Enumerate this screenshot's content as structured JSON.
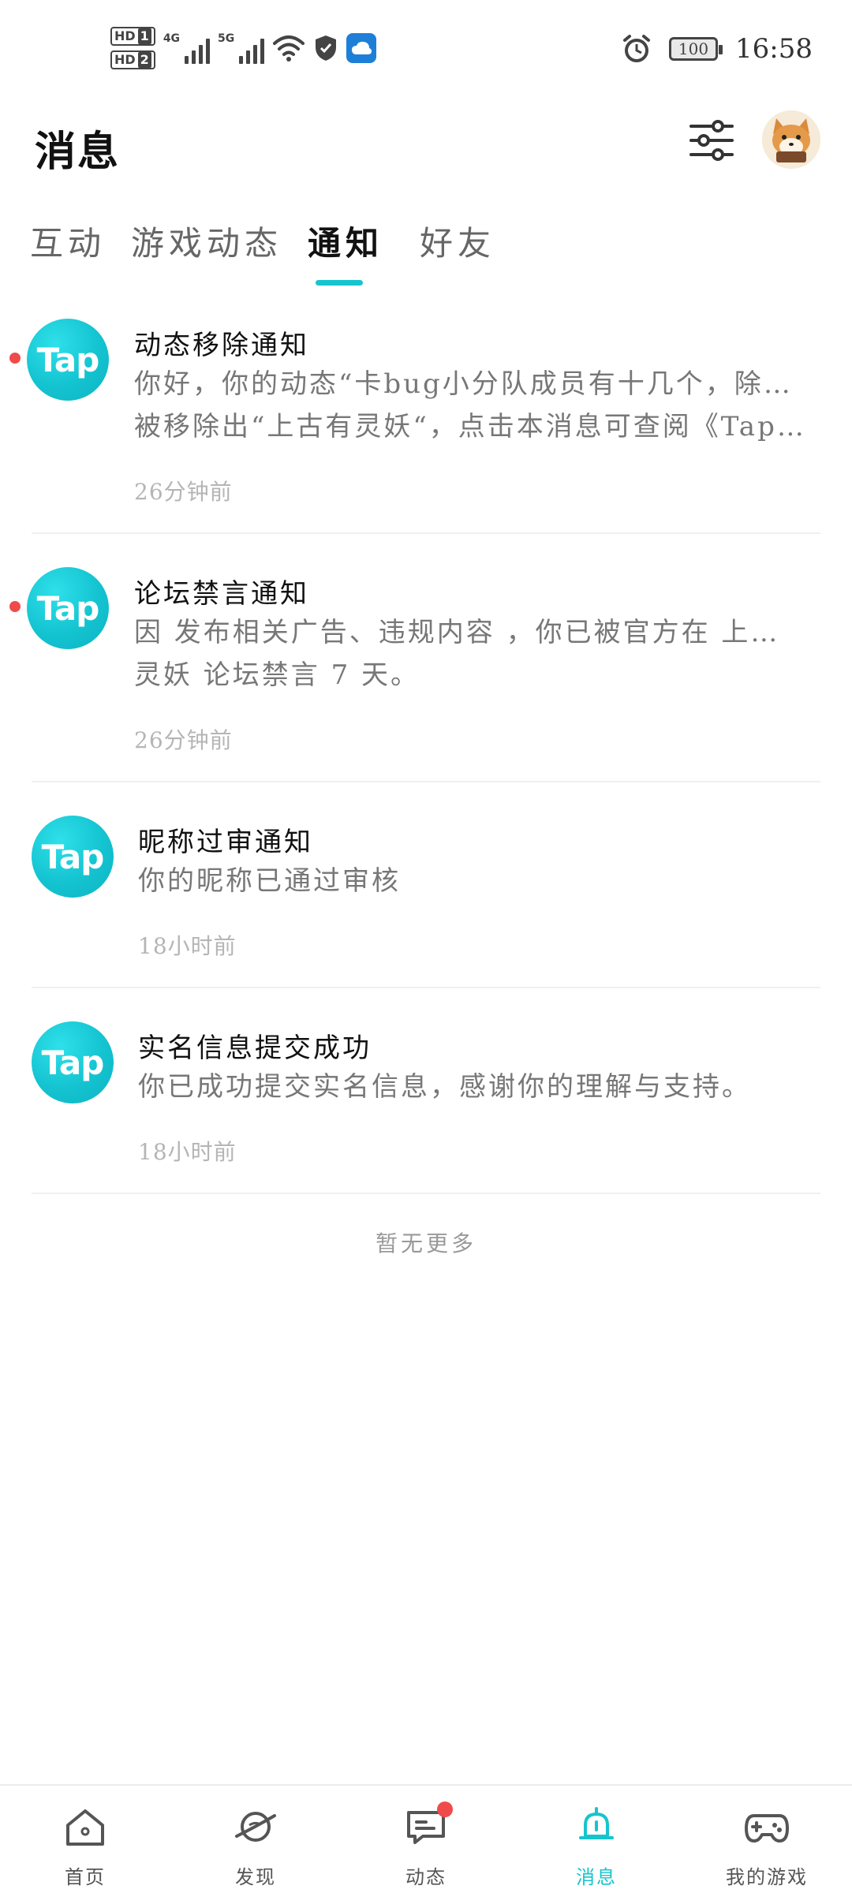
{
  "status_bar": {
    "sim1": "1",
    "sim2": "2",
    "hd_label": "HD",
    "net1": "4G",
    "net2": "5G",
    "battery": "100",
    "time": "16:58"
  },
  "header": {
    "title": "消息"
  },
  "tabs": [
    {
      "label": "互动",
      "active": false
    },
    {
      "label": "游戏动态",
      "active": false
    },
    {
      "label": "通知",
      "active": true
    },
    {
      "label": "好友",
      "active": false
    }
  ],
  "notifications": [
    {
      "logo_text": "Tap",
      "unread": true,
      "title": "动态移除通知",
      "body_lines": [
        "你好，你的动态“卡bug小分队成员有十几个，除”已",
        "被移除出“上古有灵妖“，点击本消息可查阅《Tap…"
      ],
      "time": "26分钟前"
    },
    {
      "logo_text": "Tap",
      "unread": true,
      "title": "论坛禁言通知",
      "body_lines": [
        "因 发布相关广告、违规内容 ，你已被官方在 上古有",
        "灵妖 论坛禁言 7 天。"
      ],
      "time": "26分钟前"
    },
    {
      "logo_text": "Tap",
      "unread": false,
      "title": "昵称过审通知",
      "body_lines": [
        "你的昵称已通过审核"
      ],
      "time": "18小时前"
    },
    {
      "logo_text": "Tap",
      "unread": false,
      "title": "实名信息提交成功",
      "body_lines": [
        "你已成功提交实名信息，感谢你的理解与支持。"
      ],
      "time": "18小时前"
    }
  ],
  "footer_text": "暂无更多",
  "bottom_nav": [
    {
      "label": "首页",
      "icon": "home-icon",
      "active": false,
      "badge": false
    },
    {
      "label": "发现",
      "icon": "planet-icon",
      "active": false,
      "badge": false
    },
    {
      "label": "动态",
      "icon": "chat-icon",
      "active": false,
      "badge": true
    },
    {
      "label": "消息",
      "icon": "bell-icon",
      "active": true,
      "badge": false
    },
    {
      "label": "我的游戏",
      "icon": "gamepad-icon",
      "active": false,
      "badge": false
    }
  ],
  "colors": {
    "accent": "#15c5ce",
    "unread_dot": "#ef4b4b",
    "tap_logo": "#14c3d0"
  }
}
